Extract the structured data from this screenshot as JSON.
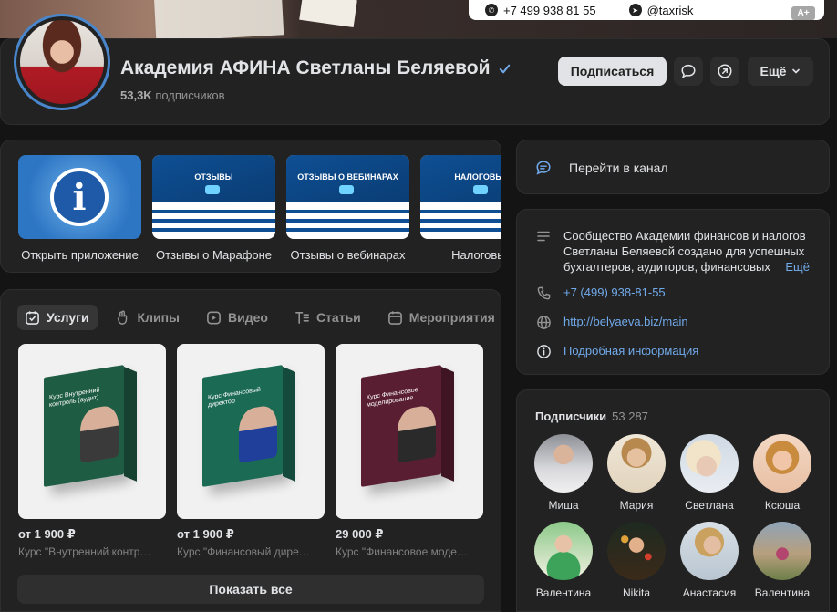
{
  "cover": {
    "phone": "+7 499 938 81 55",
    "telegram": "@taxrisk",
    "accessibility_badge": "A+"
  },
  "header": {
    "title": "Академия АФИНА Светланы Беляевой",
    "subscribers_count": "53,3K",
    "subscribers_label": "подписчиков",
    "subscribe_button": "Подписаться",
    "more_button": "Ещё"
  },
  "apps": [
    {
      "label": "Открыть приложение"
    },
    {
      "label": "Отзывы о Марафоне",
      "thumb_text": "ОТЗЫВЫ"
    },
    {
      "label": "Отзывы о вебинарах",
      "thumb_text": "ОТЗЫВЫ О ВЕБИНАРАХ"
    },
    {
      "label": "Налоговый",
      "thumb_text": "НАЛОГОВЫЙ"
    }
  ],
  "tabs": [
    {
      "label": "Услуги",
      "icon": "services-icon"
    },
    {
      "label": "Клипы",
      "icon": "clips-icon"
    },
    {
      "label": "Видео",
      "icon": "video-icon"
    },
    {
      "label": "Статьи",
      "icon": "articles-icon"
    },
    {
      "label": "Мероприятия",
      "icon": "events-icon"
    }
  ],
  "products": [
    {
      "price": "от 1 900 ₽",
      "name": "Курс \"Внутренний контр…",
      "box_text": "Курс Внутренний контроль (аудит)",
      "color": "#1f5c44"
    },
    {
      "price": "от 1 900 ₽",
      "name": "Курс \"Финансовый дире…",
      "box_text": "Курс Финансовый директор",
      "color": "#1b6a54"
    },
    {
      "price": "29 000 ₽",
      "name": "Курс \"Финансовое моде…",
      "box_text": "Курс Финансовое моделирование",
      "color": "#5a1e33"
    }
  ],
  "show_all": "Показать все",
  "sidebar": {
    "goto_channel": "Перейти в канал",
    "description": "Сообщество Академии финансов и налогов Светланы Беляевой создано для успешных бухгалтеров, аудиторов, финансовых",
    "description_more": "Ещё",
    "phone": "+7 (499) 938-81-55",
    "website": "http://belyaeva.biz/main",
    "details_link": "Подробная информация"
  },
  "followers": {
    "title": "Подписчики",
    "count": "53 287",
    "items": [
      {
        "name": "Миша"
      },
      {
        "name": "Мария"
      },
      {
        "name": "Светлана"
      },
      {
        "name": "Ксюша"
      },
      {
        "name": "Валентина"
      },
      {
        "name": "Nikita"
      },
      {
        "name": "Анастасия"
      },
      {
        "name": "Валентина"
      }
    ]
  },
  "colors": {
    "accent": "#71aaeb",
    "card_bg": "#222222",
    "page_bg": "#141414",
    "avatar_ring": "#4986cc"
  }
}
